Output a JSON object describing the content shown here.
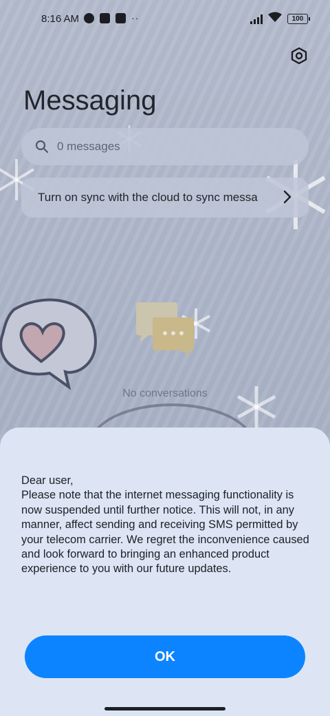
{
  "status_bar": {
    "time": "8:16 AM",
    "battery": "100",
    "more": "··"
  },
  "header": {
    "title": "Messaging",
    "settings_icon": "settings-hexagon-icon"
  },
  "search": {
    "placeholder": "0 messages",
    "icon": "search-icon"
  },
  "sync_banner": {
    "text": "Turn on sync with the cloud to sync messa",
    "icon": "chevron-right-icon"
  },
  "empty_state": {
    "text": "No conversations",
    "icon": "chat-bubbles-icon"
  },
  "dialog": {
    "lines": [
      "Dear user,",
      "Please note that the internet messaging functionality is now suspended until further notice. This will not, in any manner, affect sending and receiving SMS permitted by your telecom carrier. We regret the inconvenience caused and look forward to bringing an enhanced product experience to you with our future updates."
    ],
    "ok_label": "OK"
  },
  "colors": {
    "accent": "#0d84ff",
    "dialog_bg": "#dde5f5"
  }
}
